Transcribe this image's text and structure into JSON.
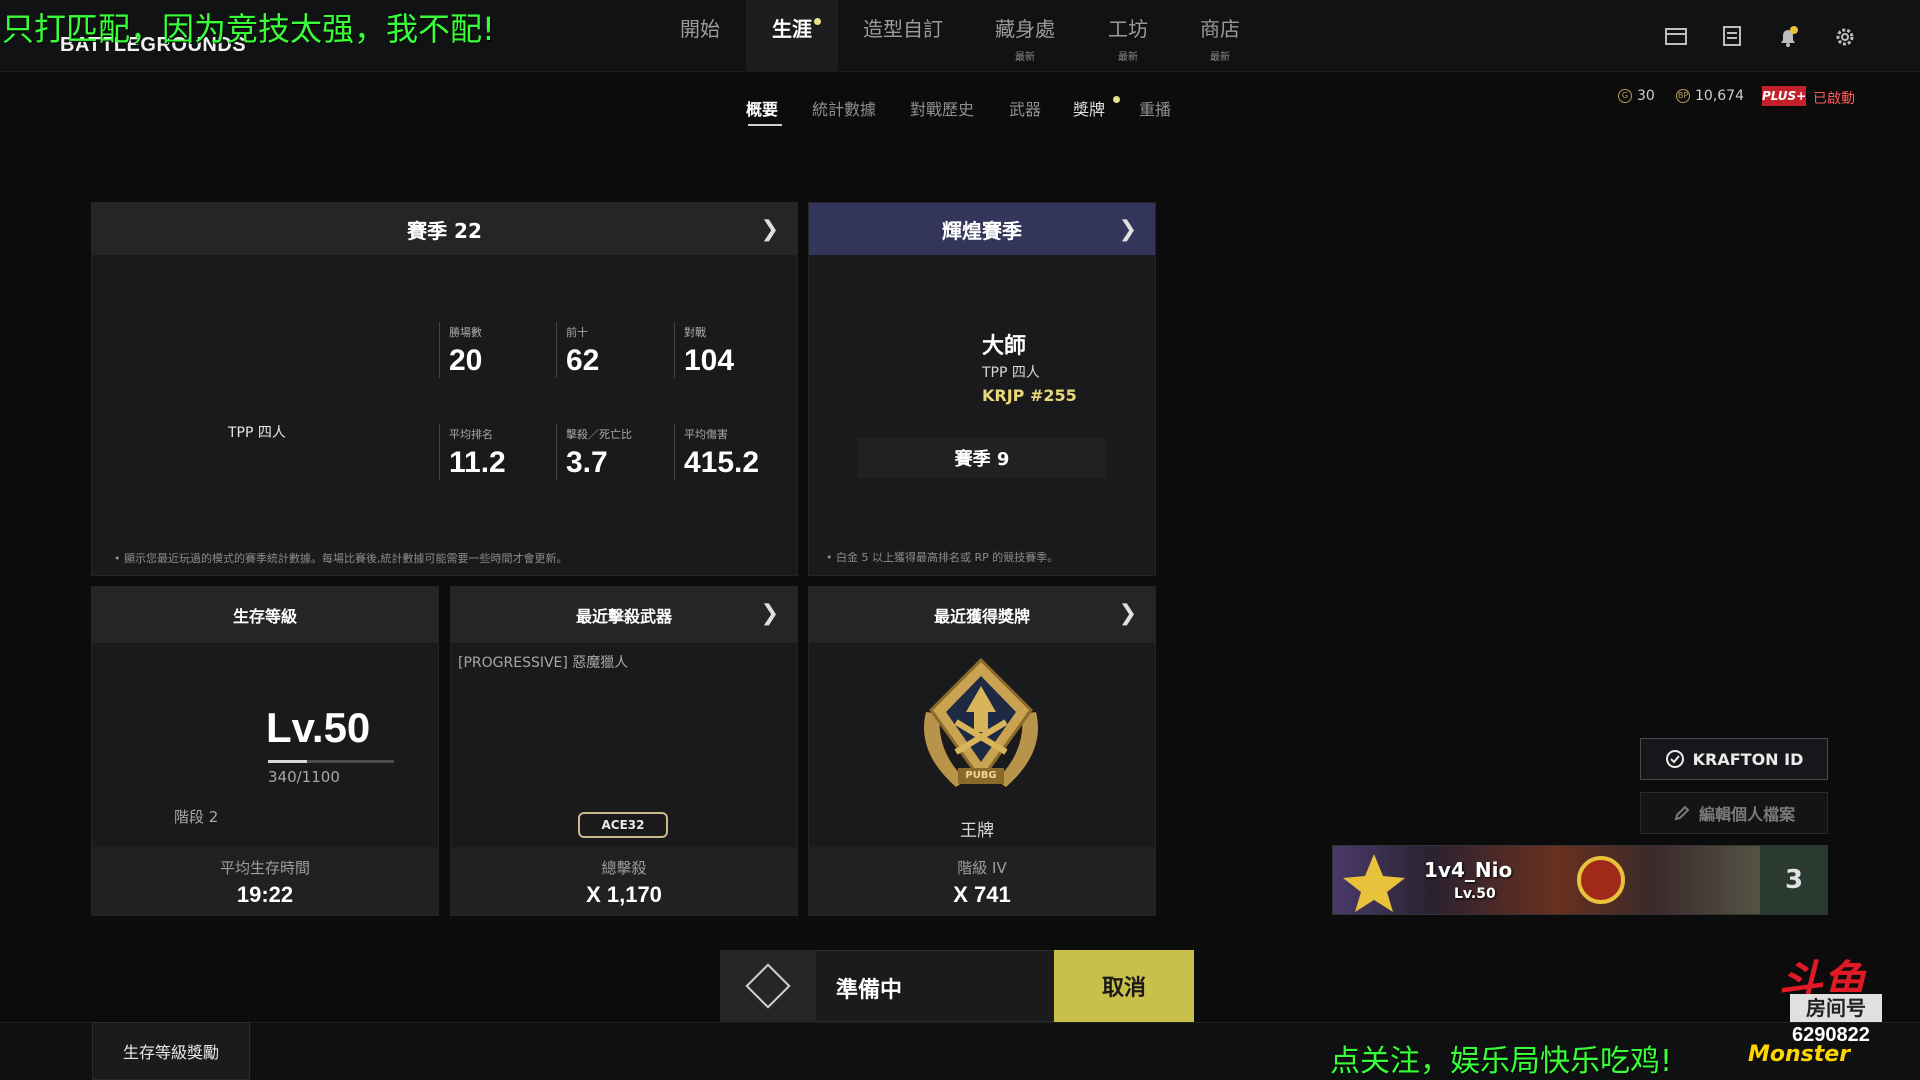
{
  "overlay": {
    "top_left": "只打匹配，因为竞技太强，我不配!",
    "bottom_right": "点关注，娱乐局快乐吃鸡!",
    "room_label": "房间号",
    "room_number": "6290822",
    "douyu_logo": "斗鱼",
    "monster_text": "Monster"
  },
  "app": {
    "logo": "BATTLEGROUNDS"
  },
  "nav": {
    "items": [
      {
        "label": "開始",
        "sub": ""
      },
      {
        "label": "生涯",
        "sub": ""
      },
      {
        "label": "造型自訂",
        "sub": ""
      },
      {
        "label": "藏身處",
        "sub": "最新"
      },
      {
        "label": "工坊",
        "sub": "最新"
      },
      {
        "label": "商店",
        "sub": "最新"
      }
    ],
    "active_index": 1
  },
  "subnav": {
    "items": [
      "概要",
      "統計數據",
      "對戰歷史",
      "武器",
      "獎牌",
      "重播"
    ],
    "active_index": 0
  },
  "currency": {
    "g_coin": "30",
    "bp": "10,674",
    "plus_badge": "PLUS+",
    "plus_status": "已啟動"
  },
  "season_panel": {
    "title": "賽季 22",
    "mode": "TPP 四人",
    "stats": [
      {
        "label": "勝場數",
        "value": "20"
      },
      {
        "label": "前十",
        "value": "62"
      },
      {
        "label": "對戰",
        "value": "104"
      },
      {
        "label": "平均排名",
        "value": "11.2"
      },
      {
        "label": "擊殺／死亡比",
        "value": "3.7"
      },
      {
        "label": "平均傷害",
        "value": "415.2"
      }
    ],
    "note": "• 顯示您最近玩過的模式的賽季統計數據。每場比賽後,統計數據可能需要一些時間才會更新。"
  },
  "glory_panel": {
    "title": "輝煌賽季",
    "tier": "大師",
    "mode": "TPP 四人",
    "rank": "KRJP #255",
    "season": "賽季 9",
    "note": "• 白金 5 以上獲得最高排名或 RP 的競技賽季。"
  },
  "survival_panel": {
    "title": "生存等級",
    "level": "Lv.50",
    "progress": "340/1100",
    "progress_fraction": 0.31,
    "stage": "階段 2",
    "footer_label": "平均生存時間",
    "footer_value": "19:22"
  },
  "weapon_panel": {
    "title": "最近擊殺武器",
    "weapon_name": "[PROGRESSIVE] 惡魔獵人",
    "weapon_tag": "ACE32",
    "footer_label": "總擊殺",
    "footer_value": "X 1,170"
  },
  "medal_panel": {
    "title": "最近獲得獎牌",
    "medal_name": "王牌",
    "medal_emblem_text": "PUBG",
    "footer_label": "階級 IV",
    "footer_value": "X 741"
  },
  "ready": {
    "status": "準備中",
    "cancel_label": "取消"
  },
  "bottom": {
    "reward_tab": "生存等級獎勵"
  },
  "profile": {
    "krafton_id_label": "KRAFTON ID",
    "edit_label": "編輯個人檔案",
    "player_name": "1v4_Nio",
    "player_level": "Lv.50",
    "rank_number": "3"
  },
  "colors": {
    "accent_yellow": "#c8c04a",
    "glory_header": "#34355a",
    "plus_red": "#c3202a",
    "overlay_green": "#39ff39"
  }
}
